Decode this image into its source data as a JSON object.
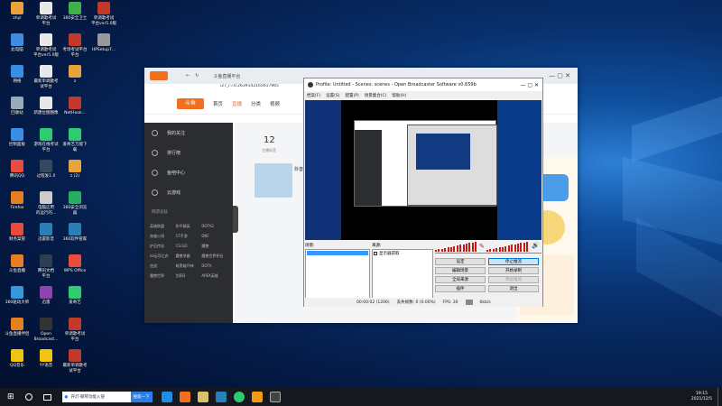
{
  "desktop": {
    "icons": [
      {
        "label": "zhyl",
        "color": "#e8a33c"
      },
      {
        "label": "单调歌考试\n平台",
        "color": "#e8e8e8"
      },
      {
        "label": "360安全卫士",
        "color": "#3fb14b"
      },
      {
        "label": "单调歌考试\n平台ver5.0版",
        "color": "#c0392b"
      },
      {
        "label": "此电脑",
        "color": "#3a8ee6"
      },
      {
        "label": "单调歌考试\n平台ver5.0版",
        "color": "#e8e8e8"
      },
      {
        "label": "考场考试平台\n平台",
        "color": "#c0392b"
      },
      {
        "label": "HPSetup7...",
        "color": "#999"
      },
      {
        "label": "网络",
        "color": "#3a8ee6"
      },
      {
        "label": "最新单调歌考\n试平台",
        "color": "#e8e8e8"
      },
      {
        "label": "z",
        "color": "#e8a33c"
      },
      {
        "label": "回收站",
        "color": "#9ab"
      },
      {
        "label": "新建位图图像",
        "color": "#e8e8e8"
      },
      {
        "label": "NetHook...",
        "color": "#c0392b"
      },
      {
        "label": "控制面板",
        "color": "#3a8ee6"
      },
      {
        "label": "游戏在线考试\n平台",
        "color": "#2ecc71"
      },
      {
        "label": "爱奇艺万能下\n载",
        "color": "#2ecc71"
      },
      {
        "label": "腾讯QQ",
        "color": "#e84c3d"
      },
      {
        "label": "过程发1.0",
        "color": "#34495e"
      },
      {
        "label": "z (2)",
        "color": "#e8a33c"
      },
      {
        "label": "Firefox",
        "color": "#e67e22"
      },
      {
        "label": "电脑应用\n的运行的...",
        "color": "#ccc"
      },
      {
        "label": "360安全浏览\n器",
        "color": "#27ae60"
      },
      {
        "label": "财务案管",
        "color": "#e74c3c"
      },
      {
        "label": "迅雷影音",
        "color": "#2980b9"
      },
      {
        "label": "360软件管家",
        "color": "#2980b9"
      },
      {
        "label": "斗鱼直播",
        "color": "#e67e22"
      },
      {
        "label": "腾讯文档\n平台",
        "color": "#2c3e50"
      },
      {
        "label": "WPS Office",
        "color": "#e74c3c"
      },
      {
        "label": "360驱动大师",
        "color": "#3498db"
      },
      {
        "label": "迅雷",
        "color": "#8e44ad"
      },
      {
        "label": "爱奇艺",
        "color": "#2ecc71"
      },
      {
        "label": "斗鱼直播伴侣",
        "color": "#e67e22"
      },
      {
        "label": "Open\nBroadcast...",
        "color": "#333"
      },
      {
        "label": "单调歌考试\n平台",
        "color": "#c0392b"
      },
      {
        "label": "QQ音乐",
        "color": "#f1c40f"
      },
      {
        "label": "YY语音",
        "color": "#f1c40f"
      },
      {
        "label": "最新单调歌考\n试平台",
        "color": "#c0392b"
      }
    ]
  },
  "browser": {
    "tab_title": "斗鱼直播平台",
    "address": "i27_r=0.26391421656179​65",
    "logo": "斗鱼",
    "nav": [
      "首页",
      "直播",
      "分类",
      "视频"
    ],
    "sidebar": [
      "我的关注",
      "排行榜",
      "鱼吧中心",
      "云游戏"
    ],
    "sidebar_section": "网游竞技",
    "sidebar_grid": [
      "英雄联盟",
      "和平精英",
      "DOTA2",
      "穿越火线",
      "CF手游",
      "DNF",
      "炉石传说",
      "CS:GO",
      "魔兽",
      "lol云顶之弈",
      "魔兽争霸",
      "魔兽世界怀旧",
      "逆战",
      "暗黑破坏神",
      "DOTA",
      "魔兽世界",
      "剑网3",
      "APEX英雄"
    ],
    "main": {
      "count": "12",
      "count_label": "主播标签",
      "ad_text": "抖音"
    }
  },
  "obs": {
    "title": "Profile: Untitled - Scenes: scenes - Open Broadcaster Software v0.659b",
    "menu": [
      "档案(F)",
      "设置(S)",
      "配置(P)",
      "场景集合(C)",
      "帮助(H)"
    ],
    "scenes_label": "场景:",
    "sources_label": "来源:",
    "source_item": "显示器获取",
    "buttons": {
      "settings": "设定",
      "stop_stream": "停止推流",
      "edit_scene": "编辑场景",
      "start_record": "开始录制",
      "global_sources": "全局来源",
      "preview": "预览推流",
      "plugins": "插件",
      "exit": "退出"
    },
    "status": {
      "time": "00:00:02 (1206)",
      "dropped": "丢失帧数: 0 (0.00%)",
      "fps": "FPS: 30",
      "kbps": "0kb/s"
    }
  },
  "taskbar": {
    "search_text": "开灯·钢琴功能入侵",
    "search_btn": "搜索一下",
    "time": "19:15",
    "date": "2021/12/5"
  }
}
